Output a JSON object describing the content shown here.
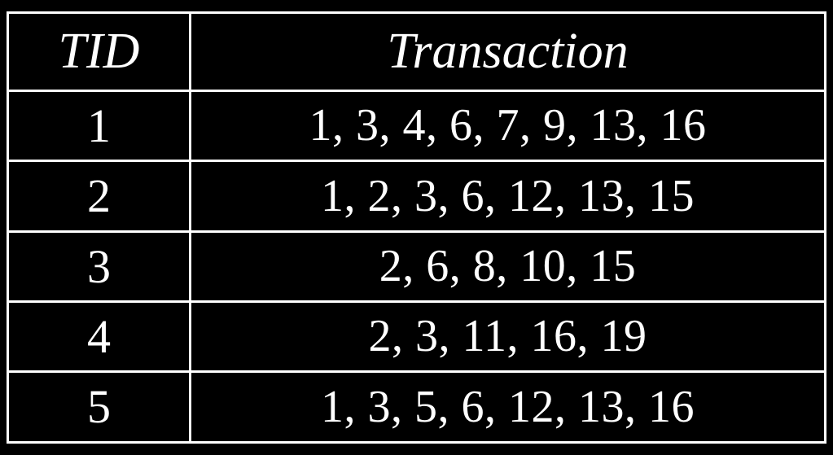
{
  "table": {
    "headers": {
      "tid": "TID",
      "transaction": "Transaction"
    },
    "rows": [
      {
        "tid": "1",
        "transaction": "1, 3, 4, 6, 7, 9, 13, 16"
      },
      {
        "tid": "2",
        "transaction": "1, 2, 3, 6, 12, 13, 15"
      },
      {
        "tid": "3",
        "transaction": "2, 6, 8, 10, 15"
      },
      {
        "tid": "4",
        "transaction": "2, 3, 11, 16, 19"
      },
      {
        "tid": "5",
        "transaction": "1, 3, 5, 6, 12, 13, 16"
      }
    ]
  }
}
